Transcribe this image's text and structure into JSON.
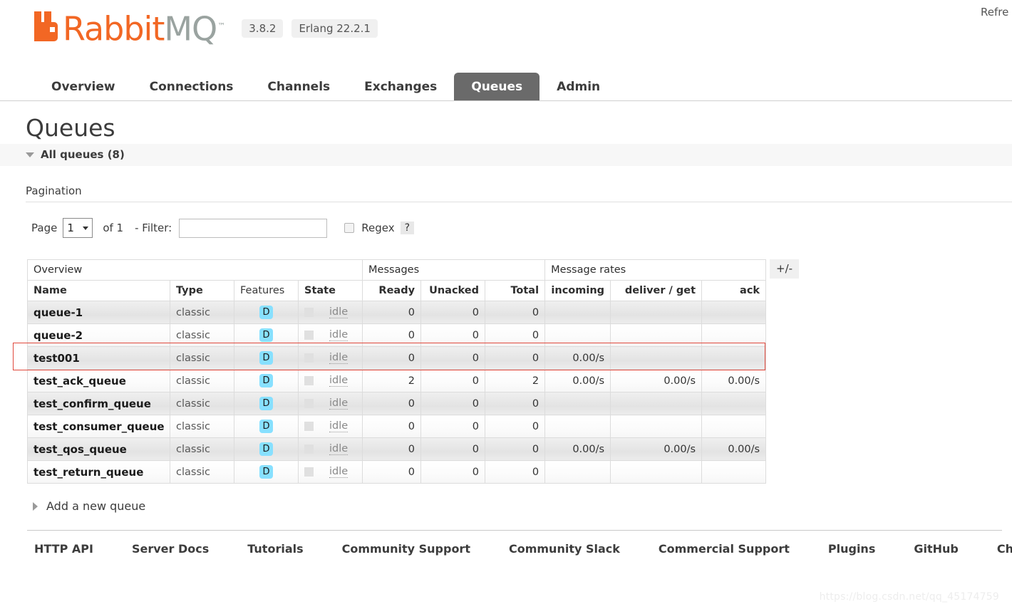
{
  "header": {
    "logo_text_primary": "Rabbit",
    "logo_text_secondary": "MQ",
    "logo_tm": "™",
    "version": "3.8.2",
    "erlang_version": "Erlang 22.2.1",
    "refresh_label": "Refre"
  },
  "nav": {
    "tabs": [
      {
        "label": "Overview",
        "active": false
      },
      {
        "label": "Connections",
        "active": false
      },
      {
        "label": "Channels",
        "active": false
      },
      {
        "label": "Exchanges",
        "active": false
      },
      {
        "label": "Queues",
        "active": true
      },
      {
        "label": "Admin",
        "active": false
      }
    ]
  },
  "page": {
    "title": "Queues",
    "all_queues_label": "All queues (8)",
    "pagination_label": "Pagination",
    "add_queue_label": "Add a new queue",
    "plus_minus_label": "+/-"
  },
  "pagination": {
    "page_label": "Page",
    "page_value": "1",
    "of_label": "of 1",
    "filter_label": "- Filter:",
    "filter_value": "",
    "filter_placeholder": "",
    "regex_label": "Regex",
    "regex_checked": false,
    "help_label": "?"
  },
  "table": {
    "groups": [
      {
        "label": "Overview",
        "span": 4
      },
      {
        "label": "Messages",
        "span": 3
      },
      {
        "label": "Message rates",
        "span": 3
      }
    ],
    "columns": [
      {
        "label": "Name",
        "align": "left",
        "bold": true
      },
      {
        "label": "Type",
        "align": "left",
        "bold": true
      },
      {
        "label": "Features",
        "align": "left",
        "bold": false
      },
      {
        "label": "State",
        "align": "left",
        "bold": true
      },
      {
        "label": "Ready",
        "align": "right",
        "bold": true
      },
      {
        "label": "Unacked",
        "align": "right",
        "bold": true
      },
      {
        "label": "Total",
        "align": "right",
        "bold": true
      },
      {
        "label": "incoming",
        "align": "right",
        "bold": true
      },
      {
        "label": "deliver / get",
        "align": "right",
        "bold": true
      },
      {
        "label": "ack",
        "align": "right",
        "bold": true
      }
    ],
    "feature_badge": "D",
    "rows": [
      {
        "name": "queue-1",
        "type": "classic",
        "features": "D",
        "state": "idle",
        "ready": "0",
        "unacked": "0",
        "total": "0",
        "incoming": "",
        "deliver_get": "",
        "ack": "",
        "highlighted": false
      },
      {
        "name": "queue-2",
        "type": "classic",
        "features": "D",
        "state": "idle",
        "ready": "0",
        "unacked": "0",
        "total": "0",
        "incoming": "",
        "deliver_get": "",
        "ack": "",
        "highlighted": false
      },
      {
        "name": "test001",
        "type": "classic",
        "features": "D",
        "state": "idle",
        "ready": "0",
        "unacked": "0",
        "total": "0",
        "incoming": "0.00/s",
        "deliver_get": "",
        "ack": "",
        "highlighted": true
      },
      {
        "name": "test_ack_queue",
        "type": "classic",
        "features": "D",
        "state": "idle",
        "ready": "2",
        "unacked": "0",
        "total": "2",
        "incoming": "0.00/s",
        "deliver_get": "0.00/s",
        "ack": "0.00/s",
        "highlighted": false
      },
      {
        "name": "test_confirm_queue",
        "type": "classic",
        "features": "D",
        "state": "idle",
        "ready": "0",
        "unacked": "0",
        "total": "0",
        "incoming": "",
        "deliver_get": "",
        "ack": "",
        "highlighted": false
      },
      {
        "name": "test_consumer_queue",
        "type": "classic",
        "features": "D",
        "state": "idle",
        "ready": "0",
        "unacked": "0",
        "total": "0",
        "incoming": "",
        "deliver_get": "",
        "ack": "",
        "highlighted": false
      },
      {
        "name": "test_qos_queue",
        "type": "classic",
        "features": "D",
        "state": "idle",
        "ready": "0",
        "unacked": "0",
        "total": "0",
        "incoming": "0.00/s",
        "deliver_get": "0.00/s",
        "ack": "0.00/s",
        "highlighted": false
      },
      {
        "name": "test_return_queue",
        "type": "classic",
        "features": "D",
        "state": "idle",
        "ready": "0",
        "unacked": "0",
        "total": "0",
        "incoming": "",
        "deliver_get": "",
        "ack": "",
        "highlighted": false
      }
    ]
  },
  "footer": {
    "links": [
      "HTTP API",
      "Server Docs",
      "Tutorials",
      "Community Support",
      "Community Slack",
      "Commercial Support",
      "Plugins",
      "GitHub",
      "Changelog"
    ]
  },
  "watermark": "https://blog.csdn.net/qq_45174759",
  "colors": {
    "brand_orange": "#f26724",
    "brand_gray": "#9aa3a0",
    "active_tab_bg": "#6a6a6a",
    "feature_badge_bg": "#87e0ff",
    "annotation_red": "#e0483c"
  }
}
